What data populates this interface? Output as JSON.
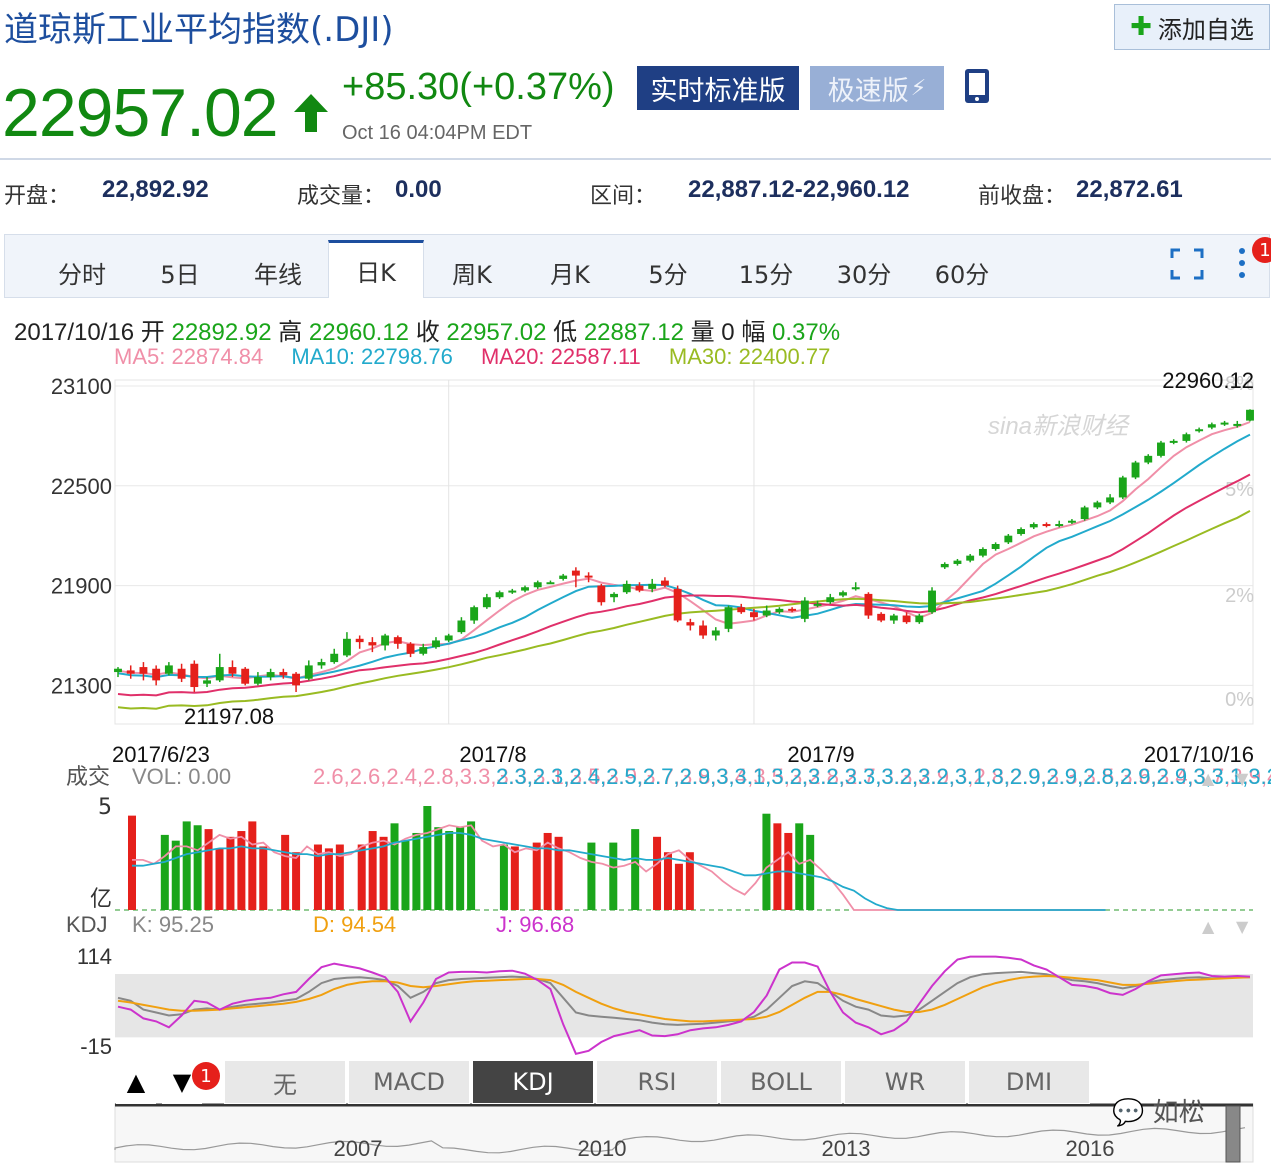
{
  "header": {
    "title": "道琼斯工业平均指数(.DJI)",
    "add_label": "添加自选",
    "price": "22957.02",
    "change": "+85.30(+0.37%)",
    "time": "Oct 16 04:04PM EDT",
    "btn_realtime": "实时标准版",
    "btn_fast": "极速版"
  },
  "stats": {
    "open_label": "开盘：",
    "open": "22,892.92",
    "volume_label": "成交量：",
    "volume": "0.00",
    "range_label": "区间：",
    "range": "22,887.12-22,960.12",
    "prev_label": "前收盘：",
    "prev": "22,872.61"
  },
  "tabs": [
    "分时",
    "5日",
    "年线",
    "日K",
    "周K",
    "月K",
    "5分",
    "15分",
    "30分",
    "60分"
  ],
  "active_tab": 3,
  "badge": "1",
  "ohlc": {
    "date": "2017/10/16",
    "open_label": "开",
    "open": "22892.92",
    "high_label": "高",
    "high": "22960.12",
    "close_label": "收",
    "close": "22957.02",
    "low_label": "低",
    "low": "22887.12",
    "vol_label": "量",
    "vol": "0",
    "amp_label": "幅",
    "amp": "0.37%"
  },
  "ma_row": {
    "ma5": "MA5: 22874.84",
    "ma10": "MA10: 22798.76",
    "ma20": "MA20: 22587.11",
    "ma30": "MA30: 22400.77"
  },
  "indicators": [
    "无",
    "MACD",
    "KDJ",
    "RSI",
    "BOLL",
    "WR",
    "DMI"
  ],
  "active_indicator": 2,
  "indicator_badge": "1",
  "wechat": "如松",
  "colors": {
    "up": "#e5201b",
    "down": "#1aa51a",
    "ma5": "#f08fa8",
    "ma10": "#22aacc",
    "ma20": "#e0306a",
    "ma30": "#99bb22",
    "k": "#888888",
    "d": "#f0a010",
    "j": "#cc33cc"
  },
  "chart_data": {
    "type": "candlestick",
    "ylim": [
      21200,
      23100
    ],
    "yticks": [
      "23100",
      "22500",
      "21900",
      "21300"
    ],
    "pct_ticks": [
      "8%",
      "5%",
      "2%",
      "0%"
    ],
    "xticks": [
      "2017/6/23",
      "2017/8",
      "2017/9",
      "2017/10/16"
    ],
    "xtick_index": [
      0,
      26,
      50,
      78
    ],
    "max_label": "22960.12",
    "min_label": "21197.08",
    "watermark": "sina新浪财经",
    "candles": [
      [
        21380,
        21400,
        21350,
        21410
      ],
      [
        21390,
        21370,
        21340,
        21420
      ],
      [
        21410,
        21370,
        21330,
        21440
      ],
      [
        21400,
        21330,
        21300,
        21420
      ],
      [
        21370,
        21420,
        21360,
        21440
      ],
      [
        21400,
        21340,
        21320,
        21430
      ],
      [
        21430,
        21290,
        21260,
        21450
      ],
      [
        21310,
        21330,
        21290,
        21350
      ],
      [
        21330,
        21410,
        21320,
        21490
      ],
      [
        21410,
        21370,
        21350,
        21450
      ],
      [
        21400,
        21310,
        21300,
        21410
      ],
      [
        21310,
        21350,
        21300,
        21380
      ],
      [
        21350,
        21380,
        21330,
        21400
      ],
      [
        21380,
        21360,
        21340,
        21400
      ],
      [
        21370,
        21300,
        21260,
        21380
      ],
      [
        21340,
        21420,
        21330,
        21450
      ],
      [
        21420,
        21440,
        21400,
        21460
      ],
      [
        21440,
        21490,
        21430,
        21520
      ],
      [
        21480,
        21580,
        21470,
        21620
      ],
      [
        21580,
        21560,
        21520,
        21600
      ],
      [
        21560,
        21540,
        21500,
        21590
      ],
      [
        21540,
        21600,
        21510,
        21610
      ],
      [
        21590,
        21550,
        21520,
        21600
      ],
      [
        21550,
        21490,
        21470,
        21560
      ],
      [
        21490,
        21530,
        21480,
        21550
      ],
      [
        21530,
        21570,
        21520,
        21590
      ],
      [
        21570,
        21600,
        21560,
        21610
      ],
      [
        21620,
        21690,
        21610,
        21710
      ],
      [
        21690,
        21770,
        21670,
        21780
      ],
      [
        21770,
        21830,
        21760,
        21850
      ],
      [
        21830,
        21860,
        21820,
        21870
      ],
      [
        21860,
        21870,
        21850,
        21880
      ],
      [
        21870,
        21890,
        21860,
        21900
      ],
      [
        21890,
        21920,
        21880,
        21930
      ],
      [
        21920,
        21920,
        21910,
        21930
      ],
      [
        21940,
        21960,
        21930,
        21970
      ],
      [
        21990,
        21960,
        21890,
        22010
      ],
      [
        21960,
        21950,
        21920,
        21980
      ],
      [
        21900,
        21800,
        21780,
        21910
      ],
      [
        21830,
        21850,
        21800,
        21860
      ],
      [
        21860,
        21910,
        21850,
        21930
      ],
      [
        21900,
        21870,
        21860,
        21920
      ],
      [
        21880,
        21910,
        21860,
        21940
      ],
      [
        21930,
        21900,
        21890,
        21950
      ],
      [
        21880,
        21690,
        21680,
        21900
      ],
      [
        21680,
        21660,
        21630,
        21700
      ],
      [
        21660,
        21600,
        21580,
        21690
      ],
      [
        21600,
        21630,
        21570,
        21650
      ],
      [
        21640,
        21770,
        21620,
        21780
      ],
      [
        21770,
        21740,
        21730,
        21790
      ],
      [
        21740,
        21710,
        21690,
        21760
      ],
      [
        21720,
        21750,
        21710,
        21780
      ],
      [
        21740,
        21760,
        21730,
        21770
      ],
      [
        21760,
        21750,
        21740,
        21770
      ],
      [
        21700,
        21810,
        21680,
        21830
      ],
      [
        21780,
        21790,
        21770,
        21810
      ],
      [
        21800,
        21830,
        21790,
        21850
      ],
      [
        21840,
        21860,
        21830,
        21870
      ],
      [
        21880,
        21890,
        21870,
        21920
      ],
      [
        21850,
        21720,
        21700,
        21860
      ],
      [
        21730,
        21690,
        21680,
        21740
      ],
      [
        21690,
        21720,
        21670,
        21730
      ],
      [
        21720,
        21680,
        21670,
        21740
      ],
      [
        21680,
        21720,
        21670,
        21730
      ],
      [
        21740,
        21870,
        21730,
        21890
      ],
      [
        22010,
        22030,
        22000,
        22040
      ],
      [
        22030,
        22050,
        22020,
        22060
      ],
      [
        22050,
        22080,
        22040,
        22090
      ],
      [
        22080,
        22120,
        22070,
        22130
      ],
      [
        22120,
        22150,
        22110,
        22160
      ],
      [
        22160,
        22200,
        22150,
        22210
      ],
      [
        22210,
        22240,
        22200,
        22250
      ],
      [
        22250,
        22270,
        22240,
        22280
      ],
      [
        22270,
        22260,
        22250,
        22280
      ],
      [
        22260,
        22270,
        22250,
        22290
      ],
      [
        22280,
        22290,
        22270,
        22300
      ],
      [
        22300,
        22370,
        22290,
        22380
      ],
      [
        22370,
        22400,
        22360,
        22410
      ],
      [
        22400,
        22430,
        22390,
        22450
      ],
      [
        22430,
        22550,
        22420,
        22560
      ],
      [
        22550,
        22640,
        22540,
        22650
      ],
      [
        22640,
        22680,
        22630,
        22690
      ],
      [
        22680,
        22760,
        22670,
        22770
      ],
      [
        22760,
        22770,
        22750,
        22780
      ],
      [
        22770,
        22810,
        22760,
        22820
      ],
      [
        22830,
        22840,
        22820,
        22850
      ],
      [
        22850,
        22870,
        22840,
        22880
      ],
      [
        22880,
        22880,
        22860,
        22890
      ],
      [
        22870,
        22872,
        22850,
        22890
      ],
      [
        22892,
        22957,
        22887,
        22960
      ]
    ],
    "volume": {
      "label": "成交",
      "vol": "VOL: 0.00",
      "ma5": [
        2.6,
        2.6,
        2.4,
        2.8,
        3.3,
        3.3,
        3.1,
        3.5,
        3.9,
        3.7,
        3.8,
        3.4,
        3.5,
        3.0,
        2.8,
        2.7,
        3.3,
        2.9,
        3.0,
        2.8,
        2.9,
        3.3,
        3.5,
        3.6,
        3.4,
        3.7,
        3.9,
        4.0,
        4.2,
        4.4,
        4.3,
        4.4,
        3.6,
        3.3,
        3.4,
        3.0,
        3.2,
        3.1,
        3.5,
        3.2,
        3.0,
        2.7,
        2.5,
        2.4,
        2.2,
        2.3,
        2.5,
        2.0,
        2.4,
        2.9,
        3.1,
        2.6,
        2.3,
        2.0,
        1.5,
        1.1,
        0.8,
        1.4,
        2.2,
        2.6,
        3.0,
        2.4,
        2.6,
        2.1,
        1.5,
        0.8,
        0.0,
        0,
        0,
        0,
        0,
        0,
        0,
        0,
        0,
        0,
        0,
        0,
        0,
        0,
        0,
        0,
        0,
        0,
        0,
        0,
        0,
        0,
        0,
        0
      ],
      "ma10": [
        2.3,
        2.3,
        2.4,
        2.5,
        2.7,
        2.9,
        3.0,
        3.1,
        3.2,
        3.2,
        3.3,
        3.2,
        3.2,
        3.1,
        3.0,
        2.9,
        2.9,
        2.8,
        2.9,
        2.9,
        3.0,
        3.1,
        3.2,
        3.3,
        3.5,
        3.6,
        3.7,
        3.8,
        3.9,
        4.0,
        4.0,
        3.9,
        3.7,
        3.6,
        3.5,
        3.4,
        3.3,
        3.2,
        3.2,
        3.1,
        3.1,
        3.0,
        2.9,
        2.8,
        2.7,
        2.6,
        2.7,
        2.6,
        2.6,
        2.7,
        2.6,
        2.5,
        2.4,
        2.3,
        2.2,
        2.0,
        1.8,
        1.8,
        1.9,
        2.0,
        2.0,
        1.9,
        1.8,
        1.7,
        1.5,
        1.2,
        1.0,
        0.6,
        0.3,
        0.1,
        0,
        0,
        0,
        0,
        0,
        0,
        0,
        0,
        0,
        0,
        0,
        0,
        0,
        0,
        0,
        0,
        0,
        0,
        0,
        0
      ],
      "yticks": [
        "5",
        "亿"
      ],
      "ylim": [
        0,
        5.4
      ],
      "bars": [
        4.9,
        0,
        0,
        3.9,
        3.6,
        4.6,
        4.4,
        4.2,
        3.2,
        3.8,
        4.1,
        4.6,
        3.3,
        0,
        3.9,
        3.0,
        0,
        3.4,
        3.2,
        3.4,
        0,
        3.4,
        4.1,
        3.8,
        4.5,
        3.6,
        4.0,
        5.4,
        4.3,
        4.1,
        4.3,
        4.6,
        0,
        0,
        3.4,
        3.3,
        0,
        3.5,
        4.0,
        3.8,
        0,
        0,
        3.5,
        0,
        3.5,
        0,
        4.2,
        0,
        3.8,
        3.0,
        2.4,
        3.0,
        0,
        0,
        0,
        0,
        0,
        0,
        5.0,
        4.5,
        4.0,
        4.5,
        3.9,
        0,
        0,
        0,
        0,
        0,
        0,
        0,
        0,
        0,
        0,
        0,
        0,
        0,
        0,
        0,
        0,
        0,
        0,
        0,
        0,
        0,
        0,
        0,
        0,
        0,
        0,
        0
      ],
      "colors": [
        "up",
        "up",
        "up",
        "down",
        "down",
        "down",
        "down",
        "up",
        "up",
        "up",
        "up",
        "up",
        "up",
        "up",
        "up",
        "up",
        "up",
        "up",
        "up",
        "up",
        "up",
        "up",
        "up",
        "up",
        "down",
        "down",
        "down",
        "down",
        "down",
        "down",
        "down",
        "down",
        "up",
        "up",
        "down",
        "up",
        "up",
        "up",
        "up",
        "up",
        "up",
        "up",
        "down",
        "down",
        "down",
        "down",
        "down",
        "down",
        "up",
        "up",
        "up",
        "up",
        "up",
        "up",
        "up",
        "up",
        "up",
        "up",
        "down",
        "up",
        "up",
        "down",
        "down",
        "down",
        "down",
        "down",
        "down",
        "down",
        "down",
        "down",
        "down",
        "down",
        "down",
        "down",
        "down",
        "down",
        "down",
        "down",
        "down",
        "down",
        "down",
        "down",
        "down",
        "down",
        "down",
        "down",
        "down",
        "down",
        "down",
        "down"
      ]
    },
    "kdj": {
      "label": "KDJ",
      "k": "K: 95.25",
      "d": "D: 94.54",
      "j": "J: 96.68",
      "yticks": [
        "114",
        "-15"
      ],
      "ylim": [
        -15,
        114
      ],
      "band": [
        20,
        80
      ],
      "K": [
        60,
        55,
        40,
        35,
        30,
        32,
        40,
        42,
        40,
        45,
        48,
        50,
        52,
        55,
        58,
        70,
        85,
        92,
        94,
        95,
        93,
        90,
        80,
        60,
        70,
        85,
        90,
        92,
        93,
        94,
        95,
        96,
        95,
        92,
        85,
        60,
        35,
        30,
        28,
        26,
        24,
        22,
        18,
        15,
        14,
        15,
        16,
        18,
        20,
        22,
        28,
        40,
        60,
        80,
        88,
        85,
        70,
        55,
        45,
        40,
        30,
        28,
        30,
        40,
        55,
        70,
        85,
        95,
        100,
        102,
        103,
        104,
        102,
        100,
        95,
        90,
        88,
        85,
        80,
        76,
        80,
        86,
        90,
        92,
        94,
        95,
        93,
        94,
        95,
        95
      ],
      "D": [
        55,
        52,
        48,
        44,
        40,
        38,
        38,
        39,
        40,
        42,
        44,
        46,
        48,
        50,
        53,
        58,
        65,
        75,
        82,
        86,
        88,
        88,
        86,
        80,
        78,
        80,
        83,
        86,
        88,
        89,
        90,
        91,
        92,
        92,
        90,
        82,
        70,
        60,
        50,
        42,
        36,
        32,
        28,
        24,
        22,
        20,
        20,
        21,
        22,
        23,
        24,
        28,
        36,
        48,
        60,
        70,
        70,
        65,
        58,
        52,
        46,
        40,
        36,
        36,
        40,
        48,
        58,
        68,
        78,
        85,
        90,
        94,
        96,
        97,
        96,
        94,
        92,
        90,
        86,
        82,
        82,
        84,
        86,
        88,
        90,
        91,
        92,
        93,
        94,
        95
      ],
      "J": [
        45,
        40,
        25,
        20,
        10,
        30,
        55,
        52,
        40,
        50,
        55,
        58,
        60,
        66,
        70,
        92,
        112,
        118,
        114,
        110,
        103,
        95,
        70,
        20,
        52,
        92,
        103,
        104,
        104,
        103,
        105,
        106,
        101,
        90,
        75,
        15,
        -35,
        -30,
        -15,
        -5,
        0,
        5,
        -4,
        -5,
        -2,
        5,
        8,
        10,
        14,
        20,
        36,
        64,
        108,
        120,
        120,
        113,
        70,
        35,
        18,
        10,
        -2,
        5,
        20,
        50,
        80,
        105,
        125,
        130,
        130,
        130,
        128,
        125,
        115,
        108,
        95,
        82,
        80,
        76,
        68,
        65,
        75,
        88,
        98,
        100,
        102,
        103,
        97,
        96,
        97,
        96
      ]
    },
    "navigator": {
      "xticks": [
        "2007",
        "2010",
        "2013",
        "2016"
      ]
    }
  }
}
